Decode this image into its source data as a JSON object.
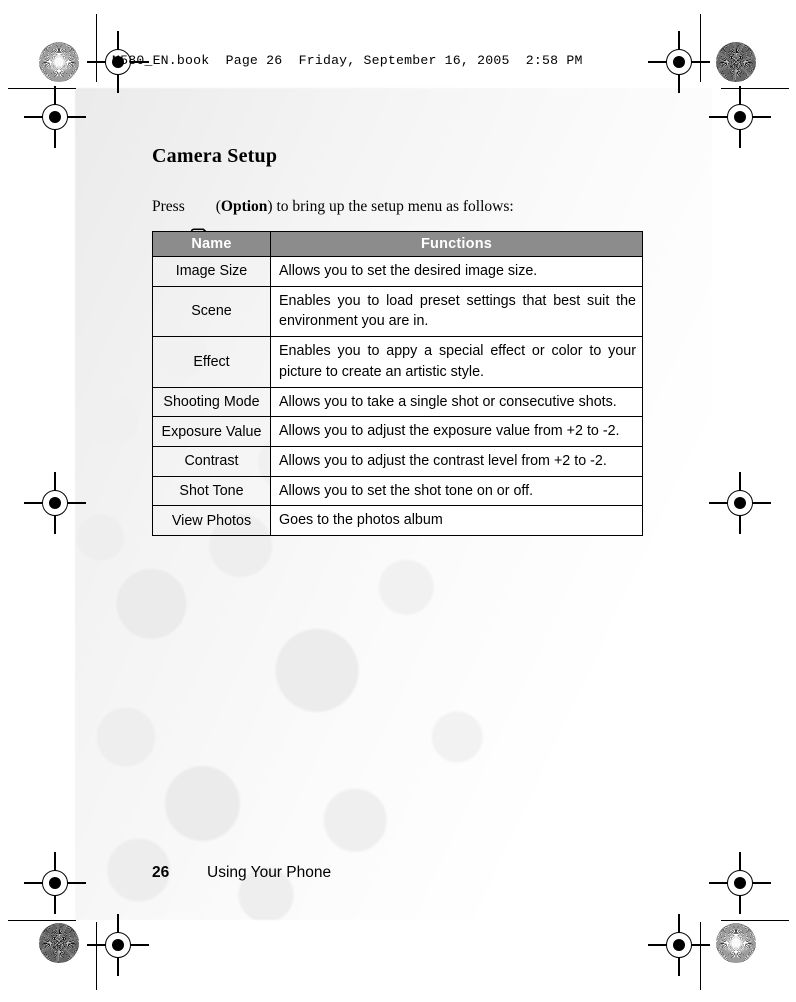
{
  "printer_slug": "M580_EN.book  Page 26  Friday, September 16, 2005  2:58 PM",
  "document": {
    "chapter_title": "Camera Setup",
    "intro": {
      "before_key": "Press",
      "key_icon": "soft-key-option-icon",
      "after_key_open": "(",
      "option_label": "Option",
      "after_key_close": ") to bring up the setup menu as follows:"
    },
    "table": {
      "headers": [
        "Name",
        "Functions"
      ],
      "rows": [
        {
          "name": "Image Size",
          "function": "Allows you to set the desired image size."
        },
        {
          "name": "Scene",
          "function": "Enables you to load preset settings that best suit the environment you are in."
        },
        {
          "name": "Effect",
          "function": "Enables you to appy a special effect or color to your picture to create an artistic style."
        },
        {
          "name": "Shooting Mode",
          "function": "Allows you to take a single shot or consecutive shots."
        },
        {
          "name": "Exposure Value",
          "function": "Allows you to adjust the exposure value from +2 to -2."
        },
        {
          "name": "Contrast",
          "function": "Allows you to adjust the contrast level from +2 to -2."
        },
        {
          "name": "Shot Tone",
          "function": "Allows you to set the shot tone on or off."
        },
        {
          "name": "View Photos",
          "function": "Goes to the photos album"
        }
      ]
    },
    "footer": {
      "page_number": "26",
      "section": "Using Your Phone"
    }
  },
  "colors": {
    "table_header_bg": "#8c8c8c",
    "table_header_text": "#ffffff",
    "table_border": "#000000",
    "text": "#000000",
    "page_bg": "#ffffff"
  }
}
